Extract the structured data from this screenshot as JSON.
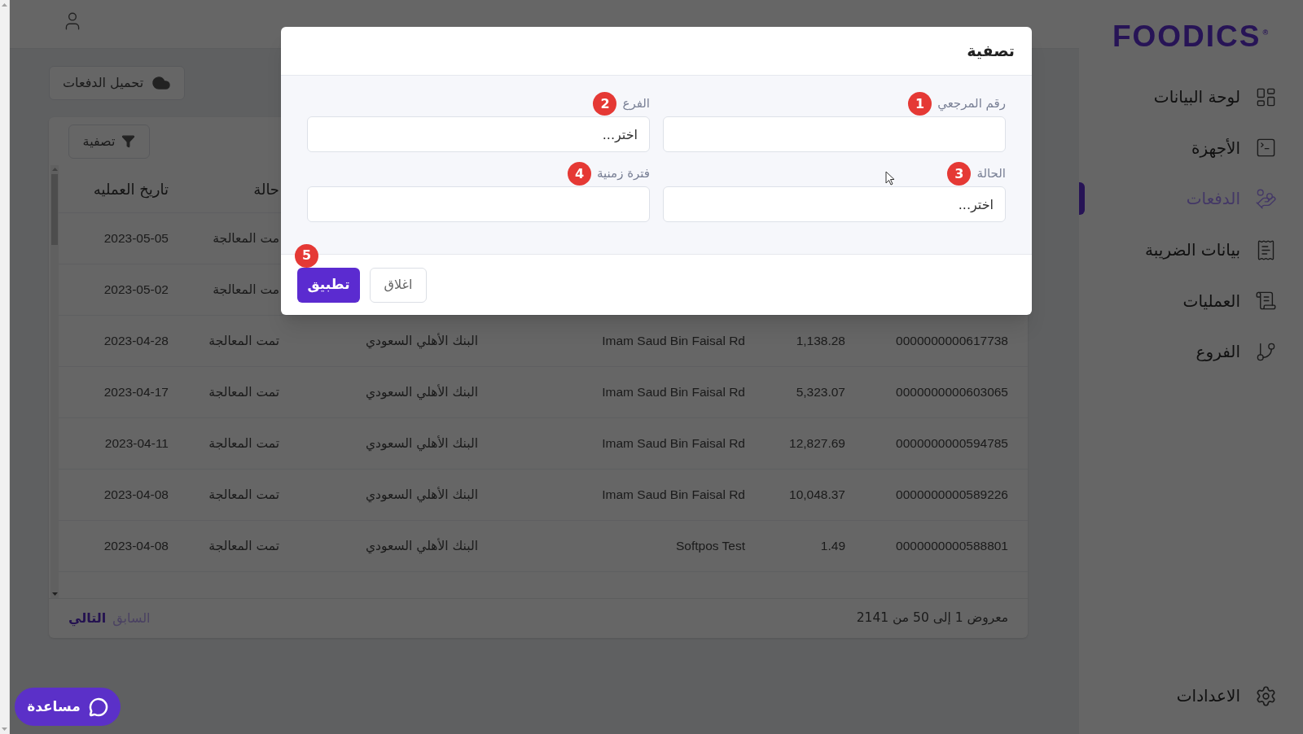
{
  "sidebar": {
    "logo": {
      "text": "FOODICS",
      "mark": "®"
    },
    "items": [
      {
        "label": "لوحة البيانات",
        "selected": false
      },
      {
        "label": "الأجهزة",
        "selected": false
      },
      {
        "label": "الدفعات",
        "selected": true
      },
      {
        "label": "بيانات الضريبة",
        "selected": false
      },
      {
        "label": "العمليات",
        "selected": false
      },
      {
        "label": "الفروع",
        "selected": false
      }
    ],
    "settings": {
      "label": "الاعدادات"
    }
  },
  "upload_button": {
    "label": "تحميل الدفعات"
  },
  "table_card": {
    "filter_button": {
      "label": "تصفية"
    },
    "headings": {
      "column_5": "حالة",
      "column_6": "تاريخ العمليه"
    },
    "rows": [
      {
        "column_5": "مت المعالجة",
        "column_6": "2023-05-05"
      },
      {
        "column_5": "مت المعالجة",
        "column_6": "2023-05-02"
      },
      {
        "column_1": "0000000000617738",
        "column_2": "1,138.28",
        "column_3": "Imam Saud Bin Faisal Rd",
        "column_4": "البنك الأهلي السعودي",
        "column_5": "تمت المعالجة",
        "column_6": "2023-04-28"
      },
      {
        "column_1": "0000000000603065",
        "column_2": "5,323.07",
        "column_3": "Imam Saud Bin Faisal Rd",
        "column_4": "البنك الأهلي السعودي",
        "column_5": "تمت المعالجة",
        "column_6": "2023-04-17"
      },
      {
        "column_1": "0000000000594785",
        "column_2": "12,827.69",
        "column_3": "Imam Saud Bin Faisal Rd",
        "column_4": "البنك الأهلي السعودي",
        "column_5": "تمت المعالجة",
        "column_6": "2023-04-11"
      },
      {
        "column_1": "0000000000589226",
        "column_2": "10,048.37",
        "column_3": "Imam Saud Bin Faisal Rd",
        "column_4": "البنك الأهلي السعودي",
        "column_5": "تمت المعالجة",
        "column_6": "2023-04-08"
      },
      {
        "column_1": "0000000000588801",
        "column_2": "1.49",
        "column_3": "Softpos Test",
        "column_4": "البنك الأهلي السعودي",
        "column_5": "تمت المعالجة",
        "column_6": "2023-04-08"
      }
    ],
    "footer": {
      "summary": "معروض 1 إلى 50 من 2141",
      "pagination": [
        {
          "label": "السابق",
          "disabled": true
        },
        {
          "label": "التالي",
          "disabled": false
        }
      ]
    }
  },
  "filter_dialog": {
    "title": "تصفية",
    "fields": [
      {
        "label": "رقم المرجعي",
        "marker": "1"
      },
      {
        "label": "الفرع",
        "marker": "2",
        "placeholder": "اختر..."
      },
      {
        "label": "الحالة",
        "marker": "3",
        "placeholder": "اختر..."
      },
      {
        "label": "فترة زمنية",
        "marker": "4"
      }
    ],
    "buttons": [
      {
        "label": "اغلاق",
        "kind": "secondary"
      },
      {
        "label": "تطبيق",
        "kind": "primary",
        "marker": "5"
      }
    ]
  },
  "help_button": {
    "label": "مساعدة"
  }
}
